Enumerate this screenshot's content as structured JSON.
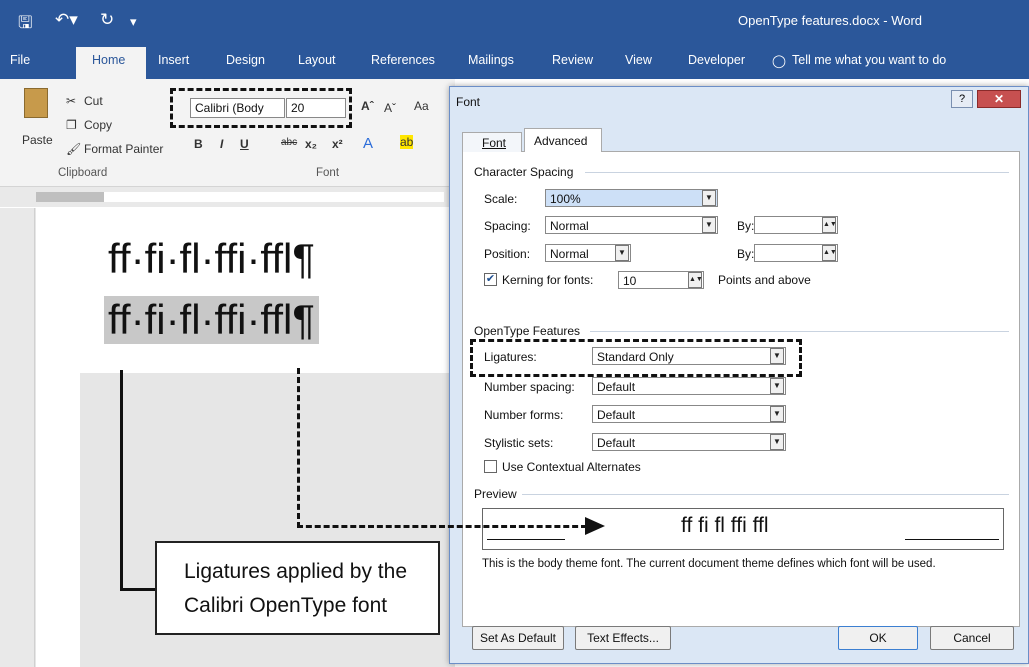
{
  "window": {
    "title": "OpenType features.docx - Word"
  },
  "qat": {
    "save_icon": "save-icon",
    "undo_icon": "undo-icon",
    "redo_icon": "redo-icon"
  },
  "ribbon": {
    "tabs": [
      "File",
      "Home",
      "Insert",
      "Design",
      "Layout",
      "References",
      "Mailings",
      "Review",
      "View",
      "Developer"
    ],
    "tell_me": "Tell me what you want to do",
    "clipboard": {
      "cut": "Cut",
      "copy": "Copy",
      "paste": "Paste",
      "format_painter": "Format Painter",
      "label": "Clipboard"
    },
    "font": {
      "name": "Calibri (Body",
      "size": "20",
      "label": "Font",
      "change_case": "Aa"
    }
  },
  "document": {
    "line1": "ff·fi·fl·ffi·ffl¶",
    "line2": "ff·fi·fl·ffi·ffl¶"
  },
  "dialog": {
    "title": "Font",
    "tabs": [
      "Font",
      "Advanced"
    ],
    "character_spacing": {
      "header": "Character Spacing",
      "scale_label": "Scale:",
      "scale_value": "100%",
      "spacing_label": "Spacing:",
      "spacing_value": "Normal",
      "position_label": "Position:",
      "position_value": "Normal",
      "by_label": "By:",
      "kerning_label": "Kerning for fonts:",
      "kerning_value": "10",
      "points_label": "Points and above"
    },
    "opentype": {
      "header": "OpenType Features",
      "ligatures_label": "Ligatures:",
      "ligatures_value": "Standard Only",
      "number_spacing_label": "Number spacing:",
      "number_spacing_value": "Default",
      "number_forms_label": "Number forms:",
      "number_forms_value": "Default",
      "stylistic_sets_label": "Stylistic sets:",
      "stylistic_sets_value": "Default",
      "contextual_label": "Use Contextual Alternates"
    },
    "preview": {
      "header": "Preview",
      "sample": "ff fi fl ffi ffl",
      "note": "This is the body theme font. The current document theme defines which font will be used."
    },
    "buttons": {
      "set_default": "Set As Default",
      "text_effects": "Text Effects...",
      "ok": "OK",
      "cancel": "Cancel"
    }
  },
  "annotation": {
    "line1": "Ligatures applied by the",
    "line2": "Calibri OpenType font"
  }
}
